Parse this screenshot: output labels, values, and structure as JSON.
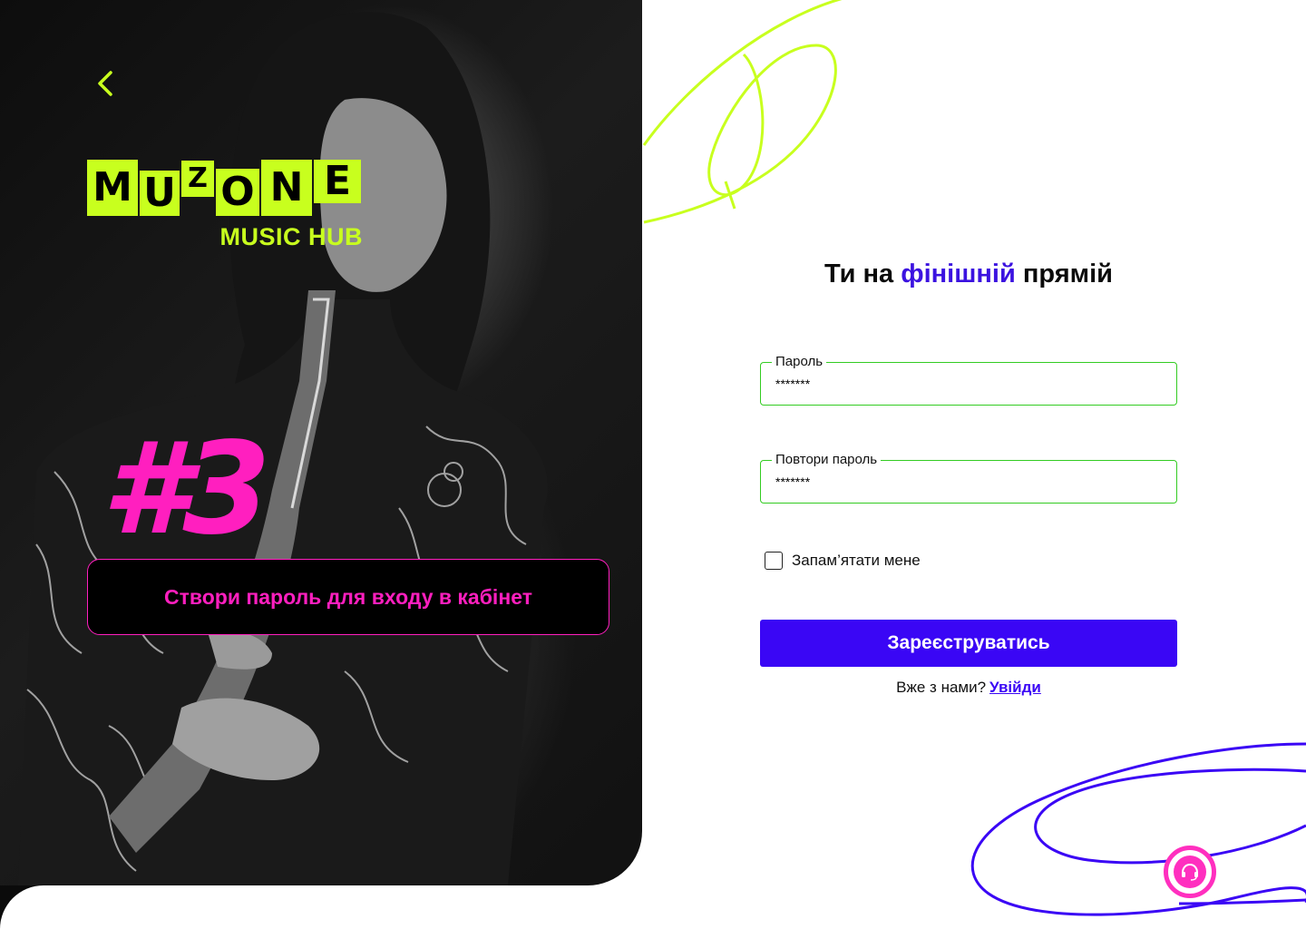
{
  "brand": {
    "logo_letters": [
      "M",
      "U",
      "Z",
      "O",
      "N",
      "E"
    ],
    "logo_text": "MUZONE",
    "subtitle": "MUSIC HUB",
    "lime": "#c8ff1e",
    "pink": "#ff1fbf",
    "violet": "#3a06f5"
  },
  "left": {
    "back_icon": "chevron-left-icon",
    "step_number": "#3",
    "step_text": "Створи пароль для входу в кабінет"
  },
  "form": {
    "title_part1": "Ти на ",
    "title_accent": "фінішній",
    "title_part2": " прямій",
    "password_label": "Пароль",
    "password_value": "*******",
    "repeat_label": "Повтори пароль",
    "repeat_value": "*******",
    "remember_label": "Запам’ятати мене",
    "submit_label": "Зареєструватись",
    "login_prompt": "Вже з нами?",
    "login_link": "Увійди"
  },
  "support": {
    "icon": "headset-icon"
  }
}
